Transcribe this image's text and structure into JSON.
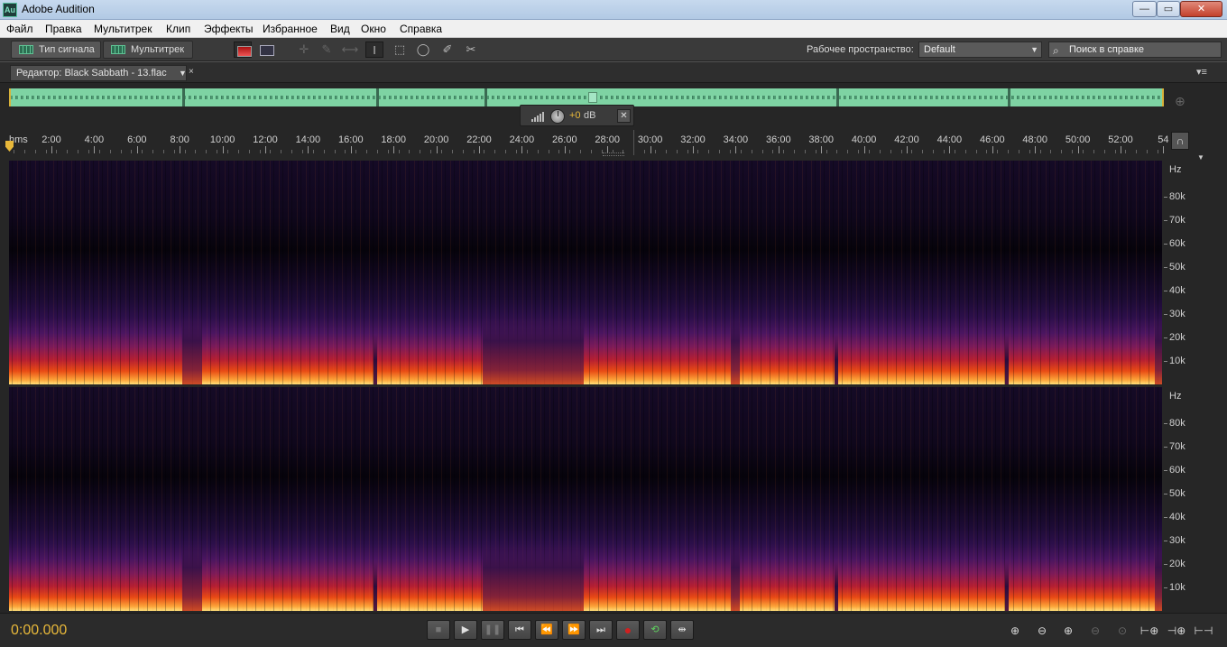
{
  "window": {
    "title": "Adobe Audition",
    "logo_text": "Au",
    "controls": {
      "minimize": "—",
      "maximize": "▭",
      "close": "✕"
    }
  },
  "menu": {
    "items": [
      "Файл",
      "Правка",
      "Мультитрек",
      "Клип",
      "Эффекты",
      "Избранное",
      "Вид",
      "Окно",
      "Справка"
    ]
  },
  "toolbar": {
    "waveform_label": "Тип сигнала",
    "multitrack_label": "Мультитрек",
    "tool_icons": [
      "spectral-display-icon",
      "frequency-display-icon",
      "move-tool-icon",
      "razor-tool-icon",
      "slip-tool-icon",
      "time-selection-tool-icon",
      "marquee-selection-tool-icon",
      "lasso-selection-tool-icon",
      "brush-selection-tool-icon",
      "spot-healing-brush-icon"
    ],
    "workspace_label": "Рабочее пространство:",
    "workspace_value": "Default",
    "help_search_placeholder": "Поиск в справке"
  },
  "panel": {
    "editor_tab_label": "Редактор: Black Sabbath - 13.flac",
    "close_glyph": "×",
    "menu_glyph": "▾≡"
  },
  "db_control": {
    "value": "+0",
    "unit": "dB",
    "pin_glyph": "✕"
  },
  "ruler": {
    "unit_label": "hms",
    "labels": [
      "2:00",
      "4:00",
      "6:00",
      "8:00",
      "10:00",
      "12:00",
      "14:00",
      "16:00",
      "18:00",
      "20:00",
      "22:00",
      "24:00",
      "26:00",
      "28:00",
      "30:00",
      "32:00",
      "34:00",
      "36:00",
      "38:00",
      "40:00",
      "42:00",
      "44:00",
      "46:00",
      "48:00",
      "50:00",
      "52:00",
      "54"
    ],
    "snap_glyph": "∩"
  },
  "spectral": {
    "axis_unit": "Hz",
    "freq_labels": [
      "80k",
      "70k",
      "60k",
      "50k",
      "40k",
      "30k",
      "20k",
      "10k"
    ],
    "colors": {
      "low": "#ffe07a",
      "mid": "#e84a14",
      "high": "#2c0f4a",
      "bg": "#0d0614"
    }
  },
  "transport": {
    "time": "0:00.000",
    "buttons": [
      {
        "name": "stop-button",
        "glyph": "■",
        "dim": true
      },
      {
        "name": "play-button",
        "glyph": "▶",
        "dim": false
      },
      {
        "name": "pause-button",
        "glyph": "❚❚",
        "dim": true
      },
      {
        "name": "go-to-start-button",
        "glyph": "⏮",
        "dim": false
      },
      {
        "name": "rewind-button",
        "glyph": "⏪",
        "dim": false
      },
      {
        "name": "fast-forward-button",
        "glyph": "⏩",
        "dim": false
      },
      {
        "name": "go-to-end-button",
        "glyph": "⏭",
        "dim": false
      },
      {
        "name": "record-button",
        "glyph": "●",
        "dim": false
      },
      {
        "name": "loop-playback-button",
        "glyph": "⟲",
        "dim": false
      },
      {
        "name": "skip-selection-button",
        "glyph": "⇹",
        "dim": false
      }
    ],
    "zoom_buttons": [
      {
        "name": "zoom-in-amplitude-button",
        "glyph": "⊕",
        "dim": false
      },
      {
        "name": "zoom-out-amplitude-button",
        "glyph": "⊖",
        "dim": false
      },
      {
        "name": "zoom-in-time-button",
        "glyph": "⊕",
        "dim": false
      },
      {
        "name": "zoom-out-time-button",
        "glyph": "⊖",
        "dim": true
      },
      {
        "name": "zoom-out-full-button",
        "glyph": "⊙",
        "dim": true
      },
      {
        "name": "zoom-in-start-button",
        "glyph": "⊢⊕",
        "dim": false
      },
      {
        "name": "zoom-in-end-button",
        "glyph": "⊣⊕",
        "dim": false
      },
      {
        "name": "zoom-selection-button",
        "glyph": "⊢⊣",
        "dim": false
      }
    ]
  }
}
